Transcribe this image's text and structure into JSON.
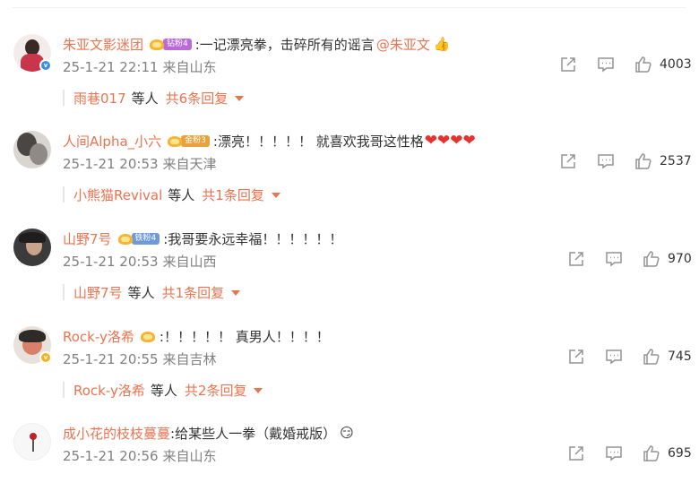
{
  "comments": [
    {
      "username": "朱亚文影迷团",
      "fan_badge": "钻粉4",
      "fan_badge_color": "#b86ad8",
      "verified": "blue",
      "text": ":一记漂亮拳，击碎所有的谣言",
      "mention": "@朱亚文",
      "emoji": "thumbs-up",
      "time": "25-1-21 22:11",
      "location": "来自山东",
      "likes": "4003",
      "replies": {
        "name": "雨巷017",
        "label": "等人",
        "total": "共6条回复"
      }
    },
    {
      "username": "人间Alpha_小六",
      "fan_badge": "金粉3",
      "fan_badge_color": "#e9a23b",
      "verified": "",
      "text": ":漂亮！！！！！ 就喜欢我哥这性格",
      "hearts": "❤❤❤❤",
      "time": "25-1-21 20:53",
      "location": "来自天津",
      "likes": "2537",
      "replies": {
        "name": "小熊猫Revival",
        "label": "等人",
        "total": "共1条回复"
      }
    },
    {
      "username": "山野7号",
      "fan_badge": "铁粉4",
      "fan_badge_color": "#6f9ad8",
      "verified": "",
      "text": ":我哥要永远幸福！！！！！！",
      "time": "25-1-21 20:53",
      "location": "来自山西",
      "likes": "970",
      "replies": {
        "name": "山野7号",
        "label": "等人",
        "total": "共1条回复"
      }
    },
    {
      "username": "Rock-y洛希",
      "fan_badge": "",
      "verified": "yellow",
      "text": ":！！！！！ 真男人！！！！",
      "time": "25-1-21 20:55",
      "location": "来自吉林",
      "likes": "745",
      "replies": {
        "name": "Rock-y洛希",
        "label": "等人",
        "total": "共2条回复"
      }
    },
    {
      "username": "成小花的枝枝蔓蔓",
      "verified": "",
      "text": ":给某些人一拳（戴婚戒版）",
      "emoji": "smug-face",
      "time": "25-1-21 20:56",
      "location": "来自山东",
      "likes": "695"
    }
  ],
  "icons": {
    "share": "share-icon",
    "comment": "comment-icon",
    "like": "like-icon"
  },
  "colors": {
    "name": "#eb7350",
    "meta": "#808080",
    "text": "#333333",
    "icon": "#939393"
  }
}
